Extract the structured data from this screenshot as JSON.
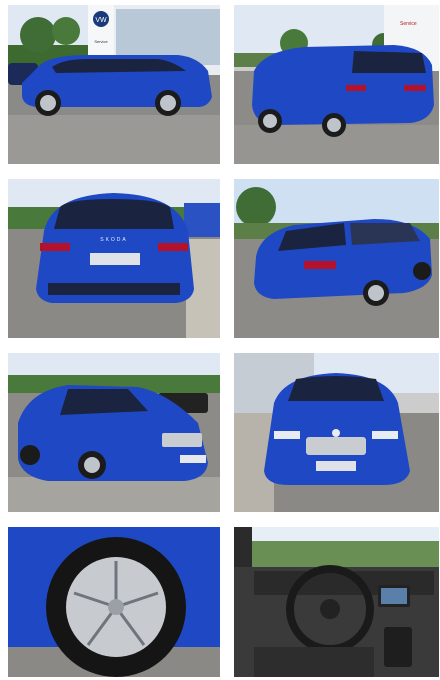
{
  "gallery": {
    "colors": {
      "car_blue": "#1f49c4",
      "sky": "#dfe8f3",
      "asphalt": "#8a8a88"
    },
    "photos": [
      {
        "id": "side-view"
      },
      {
        "id": "rear-three-quarter-view",
        "sign_text": "Service"
      },
      {
        "id": "rear-view",
        "badge_text": "SKODA"
      },
      {
        "id": "rear-right-three-quarter-view"
      },
      {
        "id": "front-left-three-quarter-view"
      },
      {
        "id": "front-view"
      },
      {
        "id": "wheel-closeup"
      },
      {
        "id": "interior-dashboard"
      }
    ],
    "dealer": {
      "side_sign_text": "Service",
      "brand_logo_text": "VW"
    }
  }
}
